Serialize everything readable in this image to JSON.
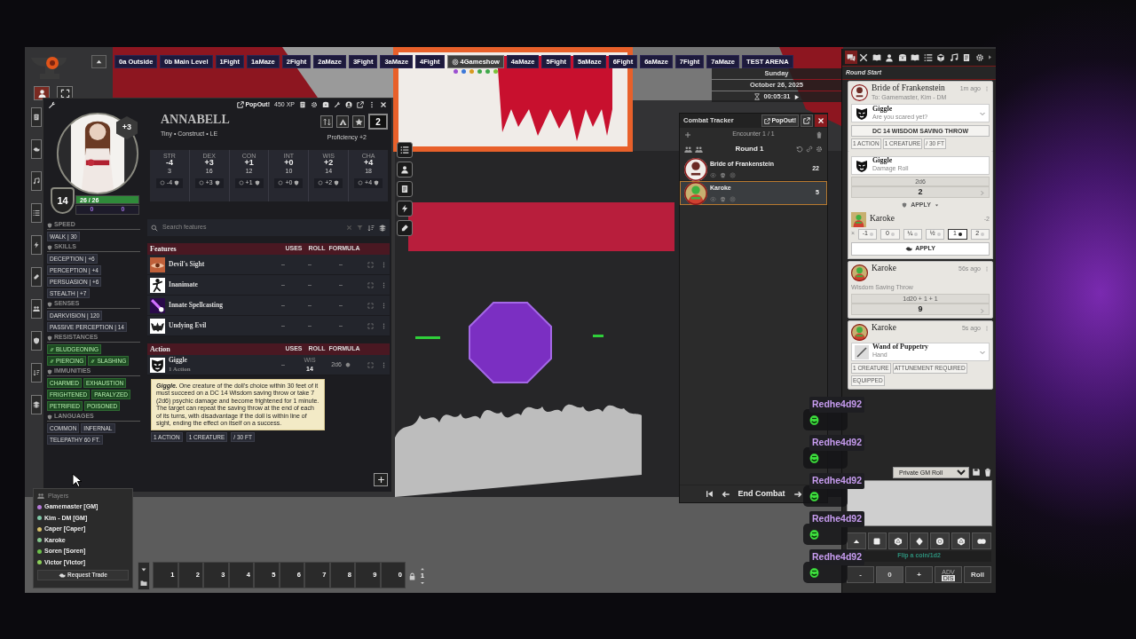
{
  "scene_nav": {
    "items": [
      {
        "label": "0a Outside",
        "selected": false
      },
      {
        "label": "0b Main Level",
        "selected": false
      },
      {
        "label": "1Fight",
        "selected": false
      },
      {
        "label": "1aMaze",
        "selected": false
      },
      {
        "label": "2Fight",
        "selected": false
      },
      {
        "label": "2aMaze",
        "selected": false
      },
      {
        "label": "3Fight",
        "selected": false
      },
      {
        "label": "3aMaze",
        "selected": false
      },
      {
        "label": "4Fight",
        "selected": false
      },
      {
        "label": "4Gameshow",
        "selected": true
      },
      {
        "label": "4aMaze",
        "selected": false
      },
      {
        "label": "5Fight",
        "selected": false
      },
      {
        "label": "5aMaze",
        "selected": false
      },
      {
        "label": "6Fight",
        "selected": false
      },
      {
        "label": "6aMaze",
        "selected": false
      },
      {
        "label": "7Fight",
        "selected": false
      },
      {
        "label": "7aMaze",
        "selected": false
      },
      {
        "label": "TEST ARENA",
        "selected": false
      }
    ],
    "viewers": [
      {
        "color": "#9b4fd0"
      },
      {
        "color": "#3b78d8"
      },
      {
        "color": "#d89a20"
      },
      {
        "color": "#3fa84a"
      },
      {
        "color": "#3fa84a"
      },
      {
        "color": "#7cc23a"
      }
    ]
  },
  "calendar": {
    "day": "Sunday",
    "date": "October 26, 2025",
    "timer": "00:05:31"
  },
  "character_sheet": {
    "popout": "PopOut!",
    "xp": "450 XP",
    "name": "ANNABELL",
    "subtitle": "Tiny • Construct • LE",
    "initiative": "+3",
    "armor_class": "14",
    "hp": {
      "value": "26 / 26",
      "level": 1
    },
    "temp_hp": "0",
    "temp_max": "0",
    "level": "2",
    "proficiency": "Proficiency +2",
    "abilities": [
      {
        "abbr": "STR",
        "mod": "-4",
        "score": "3",
        "save": "-4"
      },
      {
        "abbr": "DEX",
        "mod": "+3",
        "score": "16",
        "save": "+3"
      },
      {
        "abbr": "CON",
        "mod": "+1",
        "score": "12",
        "save": "+1"
      },
      {
        "abbr": "INT",
        "mod": "+0",
        "score": "10",
        "save": "+0"
      },
      {
        "abbr": "WIS",
        "mod": "+2",
        "score": "14",
        "save": "+2"
      },
      {
        "abbr": "CHA",
        "mod": "+4",
        "score": "18",
        "save": "+4"
      }
    ],
    "traits": [
      {
        "heading": "SPEED",
        "kind": "tag",
        "tags": [
          "WALK | 30"
        ]
      },
      {
        "heading": "SKILLS",
        "kind": "tag",
        "tags": [
          "DECEPTION | +6",
          "PERCEPTION | +4",
          "PERSUASION | +6",
          "STEALTH | +7"
        ]
      },
      {
        "heading": "SENSES",
        "kind": "tag",
        "tags": [
          "DARKVISION | 120",
          "PASSIVE PERCEPTION | 14"
        ]
      },
      {
        "heading": "RESISTANCES",
        "kind": "resistance",
        "tags": [
          "BLUDGEONING",
          "PIERCING",
          "SLASHING"
        ]
      },
      {
        "heading": "IMMUNITIES",
        "kind": "condition",
        "tags": [
          "CHARMED",
          "EXHAUSTION",
          "FRIGHTENED",
          "PARALYZED",
          "PETRIFIED",
          "POISONED"
        ]
      },
      {
        "heading": "LANGUAGES",
        "kind": "tag",
        "tags": [
          "COMMON",
          "INFERNAL",
          "TELEPATHY 60 FT."
        ]
      }
    ],
    "search": {
      "placeholder": "Search features"
    },
    "sections": [
      {
        "title": "Features",
        "columns": [
          "USES",
          "ROLL",
          "FORMULA"
        ],
        "items": [
          {
            "name": "Devil's Sight",
            "uses": "–",
            "roll": "–",
            "formula": "–"
          },
          {
            "name": "Inanimate",
            "uses": "–",
            "roll": "–",
            "formula": "–"
          },
          {
            "name": "Innate Spellcasting",
            "uses": "–",
            "roll": "–",
            "formula": "–"
          },
          {
            "name": "Undying Evil",
            "uses": "–",
            "roll": "–",
            "formula": "–"
          }
        ]
      },
      {
        "title": "Action",
        "columns": [
          "USES",
          "ROLL",
          "FORMULA"
        ],
        "items": [
          {
            "name": "Giggle",
            "detail": "1 Action",
            "uses": "–",
            "roll_label": "WIS",
            "roll": "14",
            "formula": "2d6"
          }
        ]
      }
    ],
    "tooltip": {
      "text": "**Giggle.** One creature of the doll's choice within 30 feet of it must succeed on a DC 14 Wisdom saving throw or take 7 (2d6) psychic damage and become frightened for 1 minute. The target can repeat the saving throw at the end of each of its turns, with disadvantage if the doll is within line of sight, ending the effect on itself on a success.",
      "tags": [
        "1 ACTION",
        "1 CREATURE",
        "/ 30 FT"
      ]
    }
  },
  "players": {
    "title": "Players",
    "items": [
      {
        "name": "Gamemaster [GM]",
        "color": "#b57ad8"
      },
      {
        "name": "Kim - DM [GM]",
        "color": "#7fc7a6"
      },
      {
        "name": "Caper [Caper]",
        "color": "#d6c06a"
      },
      {
        "name": "Karoke",
        "color": "#86c98f"
      },
      {
        "name": "Soren [Soren]",
        "color": "#6cc04a"
      },
      {
        "name": "Victor [Victor]",
        "color": "#8ccf5a"
      }
    ],
    "trade": "Request Trade"
  },
  "hotbar": {
    "slots": [
      "1",
      "2",
      "3",
      "4",
      "5",
      "6",
      "7",
      "8",
      "9",
      "0"
    ],
    "page": "1"
  },
  "combat_tracker": {
    "title": "Combat Tracker",
    "popout": "PopOut!",
    "encounter": "Encounter 1 / 1",
    "round": "Round 1",
    "combatants": [
      {
        "name": "Bride of Frankenstein",
        "initiative": "22",
        "selected": false
      },
      {
        "name": "Karoke",
        "initiative": "5",
        "selected": true
      }
    ],
    "end": "End Combat"
  },
  "chat": {
    "tabs": [
      {
        "selected": true
      },
      {
        "selected": false
      },
      {
        "selected": false
      },
      {
        "selected": false
      },
      {
        "selected": false
      },
      {
        "selected": false
      },
      {
        "selected": false
      },
      {
        "selected": false
      },
      {
        "selected": false
      },
      {
        "selected": false
      },
      {
        "selected": false
      }
    ],
    "header": "Round Start",
    "messages": [
      {
        "kind": "item",
        "speaker": "Bride of Frankenstein",
        "time": "1m ago",
        "whisper": "To: Gamemaster, Kim - DM",
        "item": "Giggle",
        "item_detail": "Are you scared yet?",
        "button": "DC 14 WISDOM SAVING THROW",
        "tags": [
          "1 ACTION",
          "1 CREATURE",
          "/ 30 FT"
        ]
      },
      {
        "kind": "damage",
        "item": "Giggle",
        "item_detail": "Damage Roll",
        "formula": "2d6",
        "total": "2",
        "apply_menu": "APPLY",
        "target": "Karoke",
        "target_delta": "-2",
        "multiplier_prefix": "×",
        "multipliers": [
          {
            "label": "-1",
            "selected": false
          },
          {
            "label": "0",
            "selected": false
          },
          {
            "label": "¼",
            "selected": false
          },
          {
            "label": "½",
            "selected": false
          },
          {
            "label": "1",
            "selected": true
          },
          {
            "label": "2",
            "selected": false
          }
        ],
        "apply": "APPLY"
      },
      {
        "kind": "roll",
        "speaker": "Karoke",
        "time": "56s ago",
        "flavor": "Wisdom Saving Throw",
        "formula": "1d20 + 1 + 1",
        "total": "9"
      },
      {
        "kind": "item",
        "speaker": "Karoke",
        "time": "5s ago",
        "item": "Wand of Puppetry",
        "item_detail": "Hand",
        "tags": [
          "1 CREATURE",
          "ATTUNEMENT REQUIRED",
          "EQUIPPED"
        ]
      }
    ],
    "roll_mode": "Private GM Roll",
    "dice_hint": "Flip a coin/1d2",
    "minus": "-",
    "modifier": "0",
    "plus": "+",
    "adv": "ADV",
    "dis": "DIS",
    "roll": "Roll"
  },
  "stream_chat": {
    "messages": [
      {
        "user": "Redhe4d92"
      },
      {
        "user": "Redhe4d92"
      },
      {
        "user": "Redhe4d92"
      },
      {
        "user": "Redhe4d92"
      },
      {
        "user": "Redhe4d92"
      }
    ]
  }
}
